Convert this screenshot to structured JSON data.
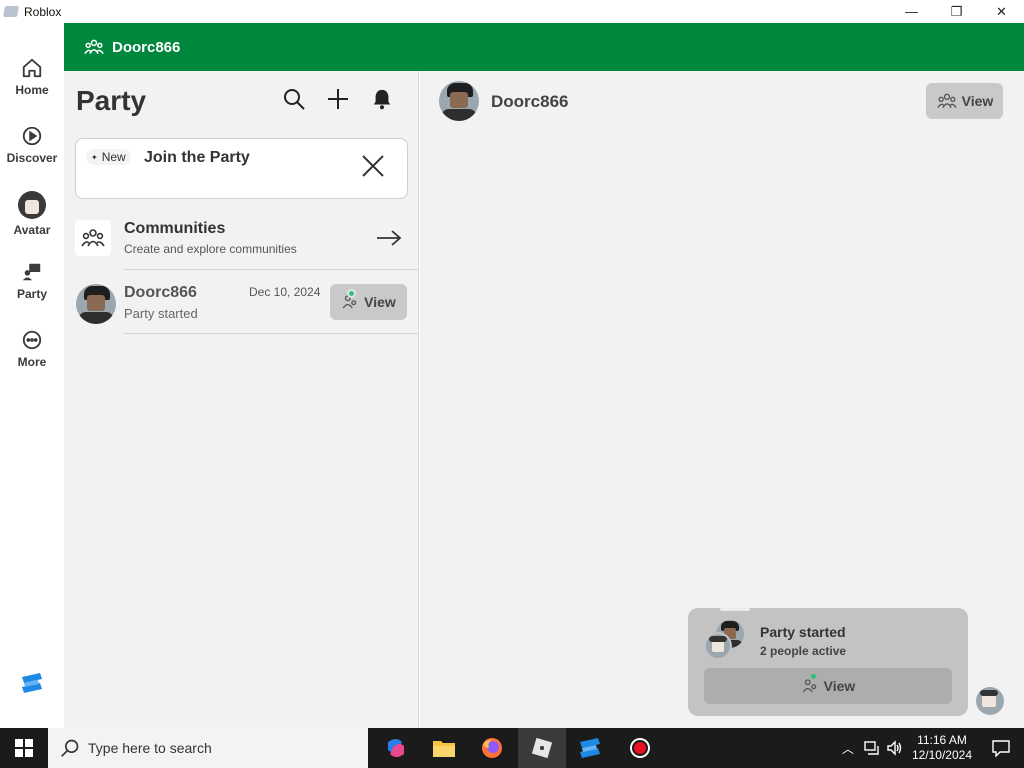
{
  "window": {
    "title": "Roblox",
    "min_glyph": "—",
    "restore_glyph": "❐",
    "close_glyph": "✕"
  },
  "nav": {
    "items": [
      {
        "label": "Home",
        "icon": "home-icon"
      },
      {
        "label": "Discover",
        "icon": "play-circle-icon"
      },
      {
        "label": "Avatar",
        "icon": "avatar-icon"
      },
      {
        "label": "Party",
        "icon": "party-icon"
      },
      {
        "label": "More",
        "icon": "more-icon"
      }
    ]
  },
  "header": {
    "party_name": "Doorc866"
  },
  "left": {
    "title": "Party",
    "new_card": {
      "badge": "New",
      "title": "Join the Party"
    },
    "communities": {
      "title": "Communities",
      "subtitle": "Create and explore communities"
    },
    "conversation": {
      "name": "Doorc866",
      "status": "Party started",
      "date": "Dec 10, 2024",
      "view_label": "View"
    }
  },
  "right": {
    "name": "Doorc866",
    "view_label": "View",
    "toast": {
      "title": "Party started",
      "subtitle": "2 people active",
      "view_label": "View"
    }
  },
  "taskbar": {
    "search_placeholder": "Type here to search",
    "time": "11:16 AM",
    "date": "12/10/2024"
  },
  "colors": {
    "brand_green": "#00873e",
    "online_dot": "#2ec27e"
  }
}
